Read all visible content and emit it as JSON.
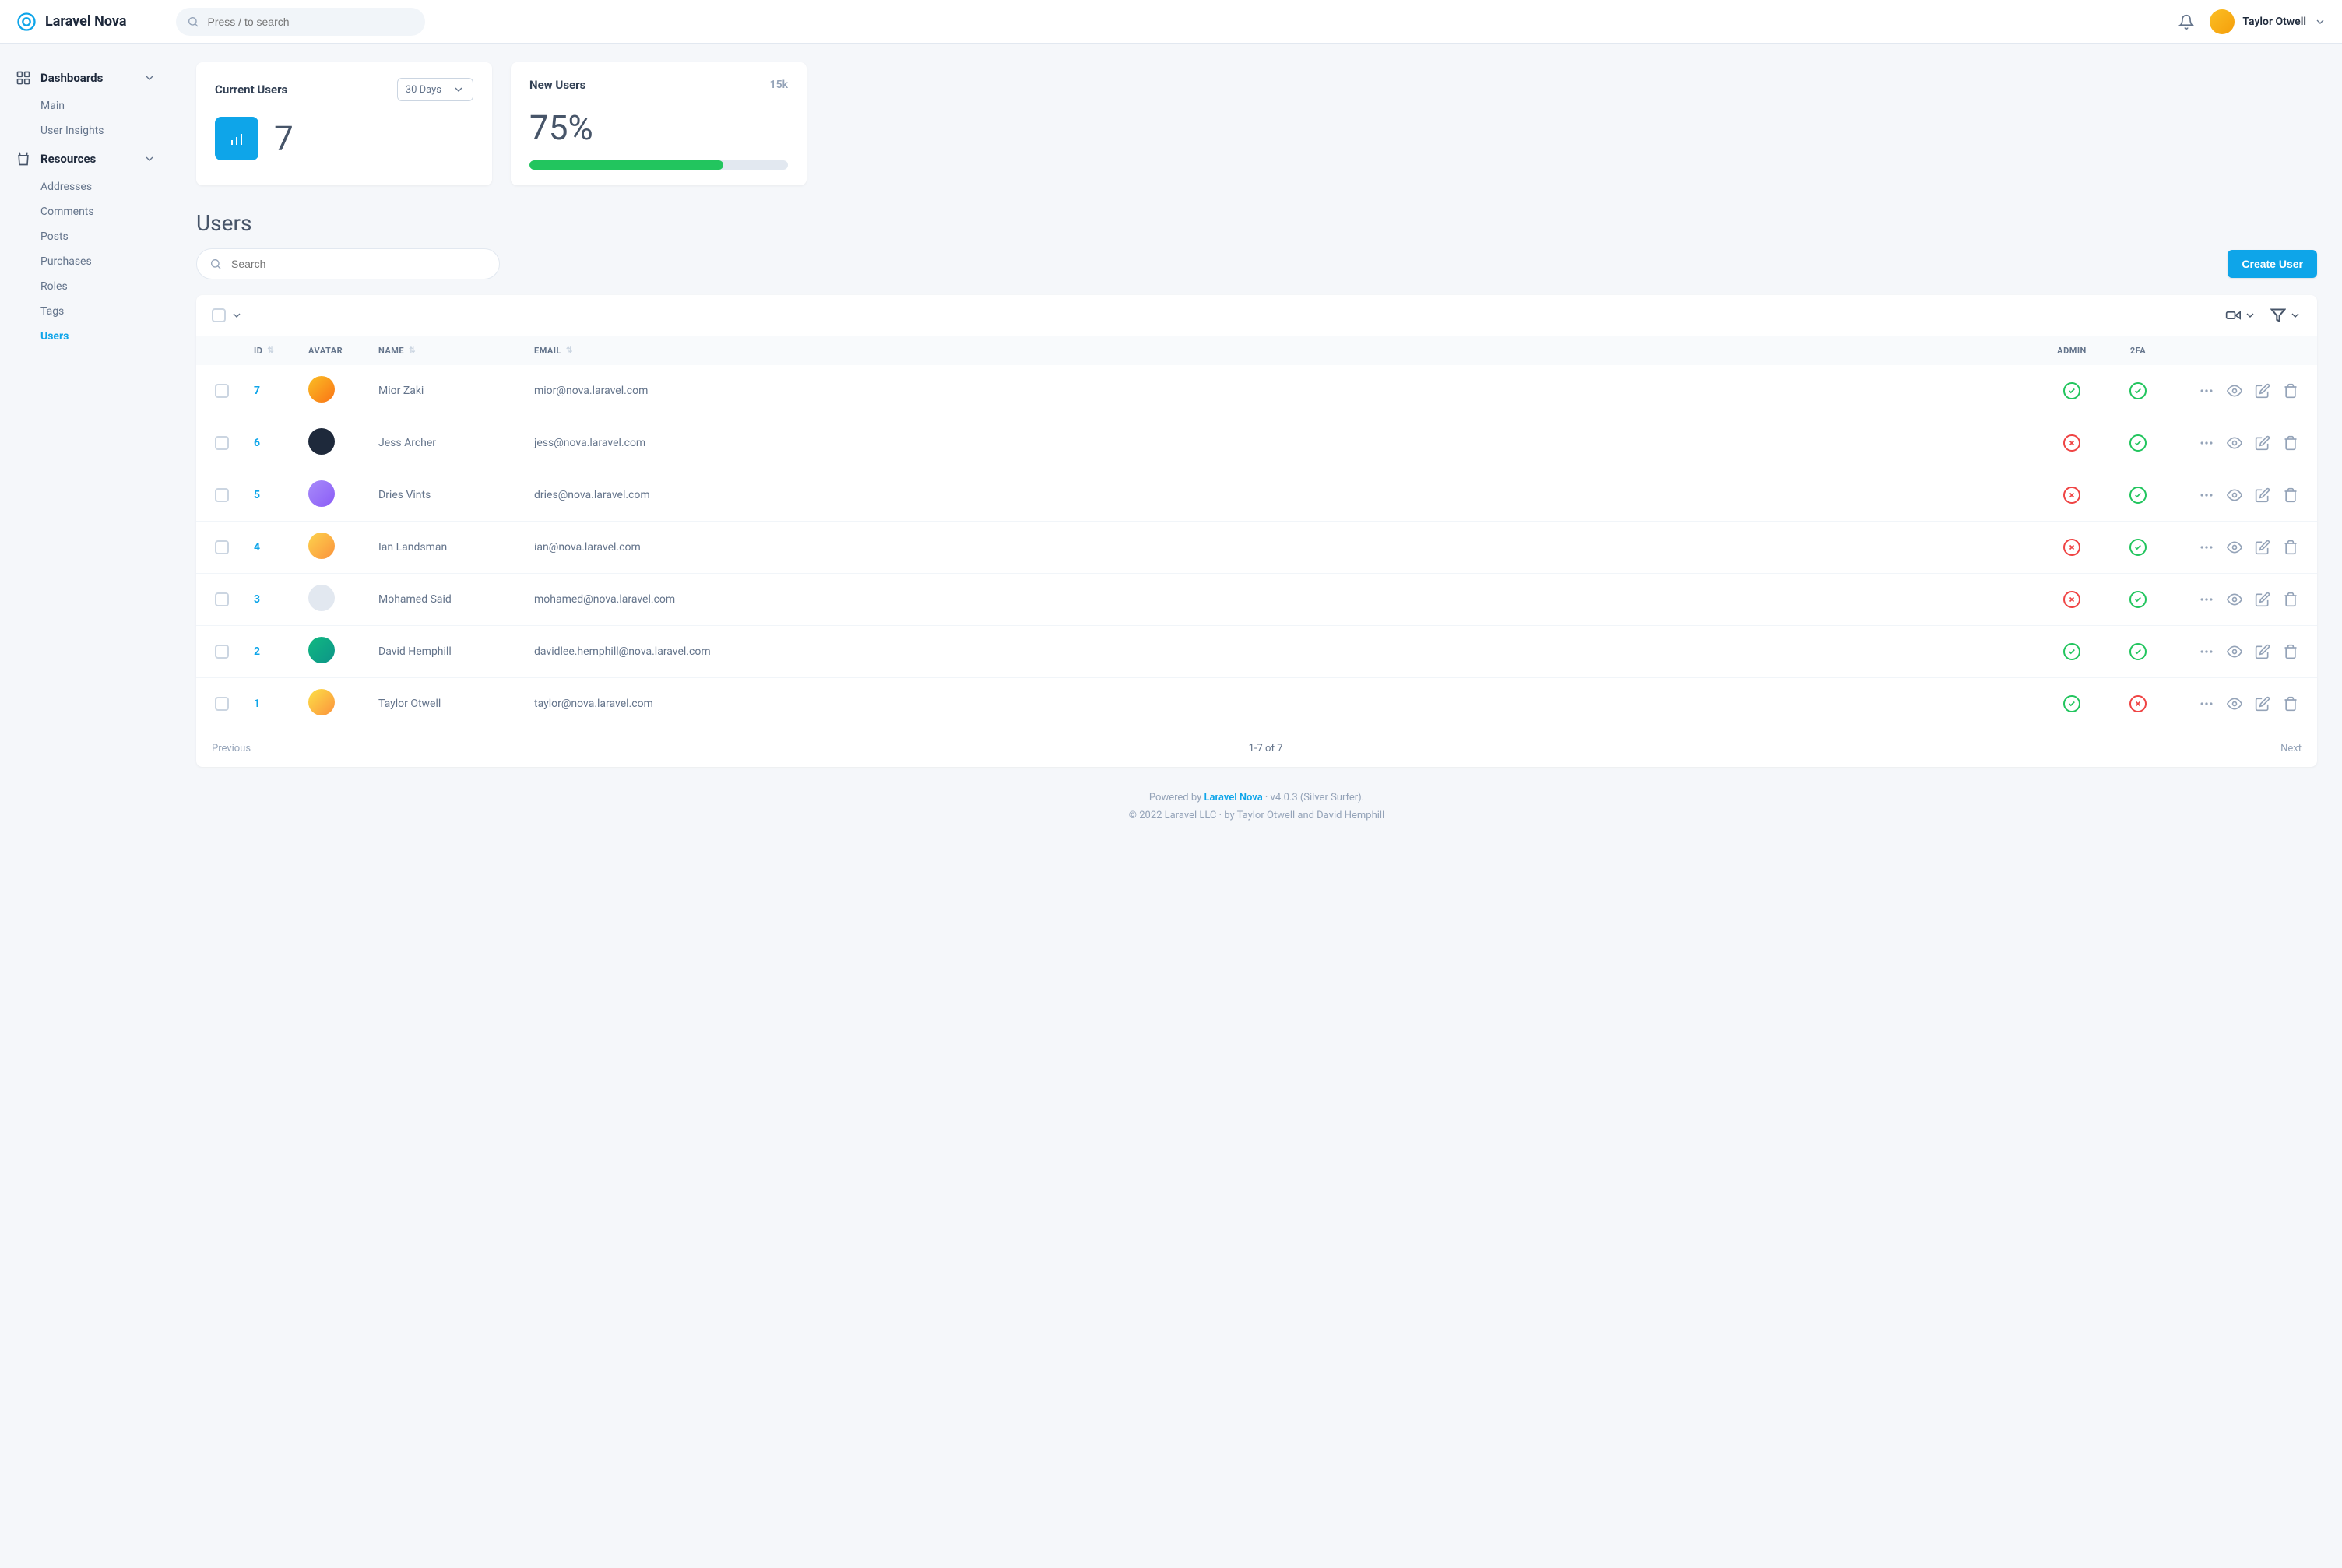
{
  "brand": "Laravel Nova",
  "header": {
    "search_placeholder": "Press / to search",
    "user_name": "Taylor Otwell"
  },
  "sidebar": {
    "groups": [
      {
        "label": "Dashboards",
        "items": [
          {
            "label": "Main",
            "key": "main"
          },
          {
            "label": "User Insights",
            "key": "user-insights"
          }
        ]
      },
      {
        "label": "Resources",
        "items": [
          {
            "label": "Addresses",
            "key": "addresses"
          },
          {
            "label": "Comments",
            "key": "comments"
          },
          {
            "label": "Posts",
            "key": "posts"
          },
          {
            "label": "Purchases",
            "key": "purchases"
          },
          {
            "label": "Roles",
            "key": "roles"
          },
          {
            "label": "Tags",
            "key": "tags"
          },
          {
            "label": "Users",
            "key": "users",
            "active": true
          }
        ]
      }
    ]
  },
  "cards": {
    "current_users": {
      "title": "Current Users",
      "period": "30 Days",
      "value": "7"
    },
    "new_users": {
      "title": "New Users",
      "stat": "15k",
      "percent": "75%",
      "progress": 75
    }
  },
  "page": {
    "title": "Users",
    "search_placeholder": "Search",
    "create_button": "Create User"
  },
  "table": {
    "columns": {
      "id": "ID",
      "avatar": "AVATAR",
      "name": "NAME",
      "email": "EMAIL",
      "admin": "ADMIN",
      "2fa": "2FA"
    },
    "rows": [
      {
        "id": "7",
        "name": "Mior Zaki",
        "email": "mior@nova.laravel.com",
        "admin": true,
        "twofa": true
      },
      {
        "id": "6",
        "name": "Jess Archer",
        "email": "jess@nova.laravel.com",
        "admin": false,
        "twofa": true
      },
      {
        "id": "5",
        "name": "Dries Vints",
        "email": "dries@nova.laravel.com",
        "admin": false,
        "twofa": true
      },
      {
        "id": "4",
        "name": "Ian Landsman",
        "email": "ian@nova.laravel.com",
        "admin": false,
        "twofa": true
      },
      {
        "id": "3",
        "name": "Mohamed Said",
        "email": "mohamed@nova.laravel.com",
        "admin": false,
        "twofa": true
      },
      {
        "id": "2",
        "name": "David Hemphill",
        "email": "davidlee.hemphill@nova.laravel.com",
        "admin": true,
        "twofa": true
      },
      {
        "id": "1",
        "name": "Taylor Otwell",
        "email": "taylor@nova.laravel.com",
        "admin": true,
        "twofa": false
      }
    ],
    "footer": {
      "prev": "Previous",
      "range": "1-7 of 7",
      "next": "Next"
    }
  },
  "footer": {
    "line1_prefix": "Powered by ",
    "line1_link": "Laravel Nova",
    "line1_suffix": " · v4.0.3 (Silver Surfer).",
    "line2": "© 2022 Laravel LLC · by Taylor Otwell and David Hemphill"
  }
}
